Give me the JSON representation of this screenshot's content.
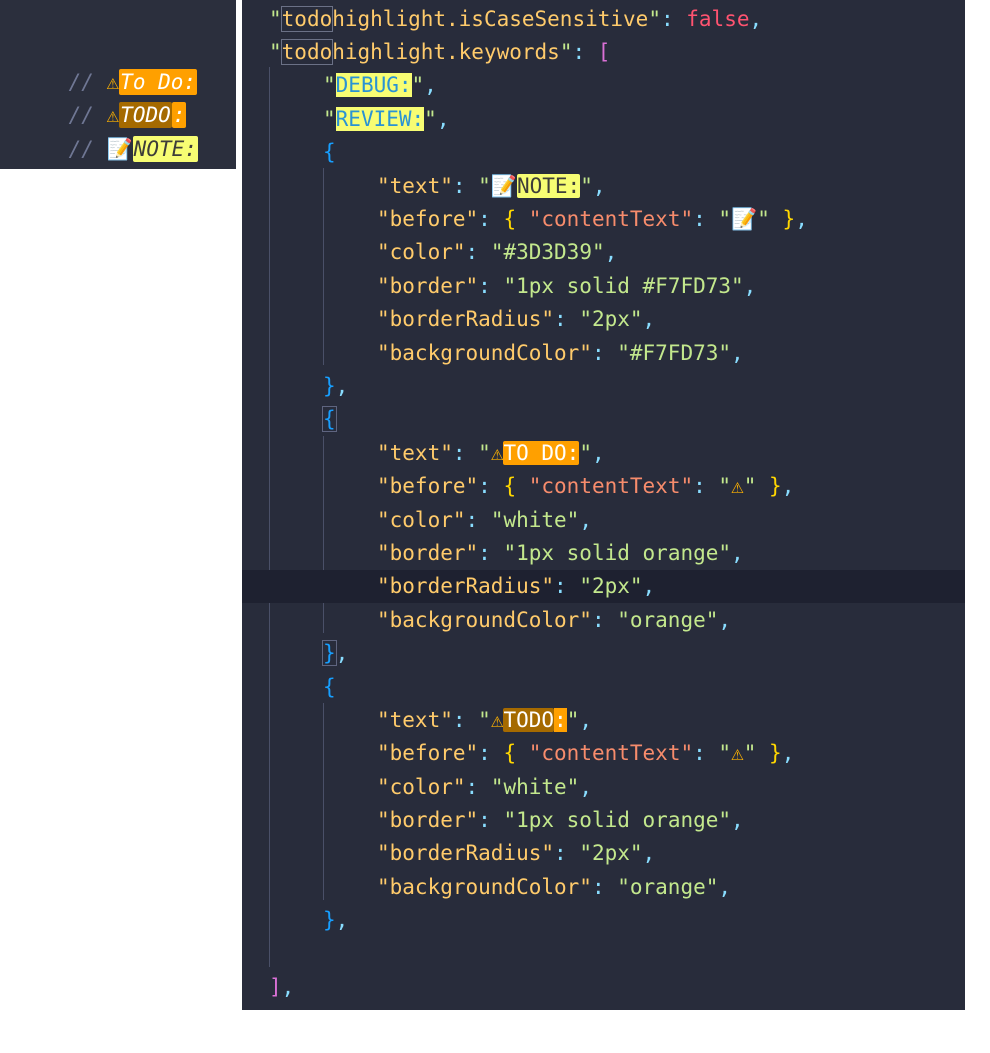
{
  "preview": {
    "rows": [
      {
        "comment": "// ",
        "icon": "⚠",
        "tag": "To Do:",
        "style": "orange"
      },
      {
        "comment": "// ",
        "icon": "⚠",
        "tag": "TODO",
        "colon": ":",
        "style": "dark"
      },
      {
        "comment": "// ",
        "icon": "📝",
        "tag": "NOTE:",
        "style": "yellow"
      }
    ]
  },
  "editor": {
    "lines": [
      {
        "q1": "\"",
        "k1": "todo",
        "k2": "highlight.isCaseSensitive",
        "q2": "\"",
        "sep": ": ",
        "val": "false",
        "tail": ","
      },
      {
        "q1": "\"",
        "k1": "todo",
        "k2": "highlight.keywords",
        "q2": "\"",
        "sep": ": ",
        "bracket": "["
      },
      {
        "s1": "\"",
        "tag": "DEBUG:",
        "s2": "\"",
        "tail": ","
      },
      {
        "s1": "\"",
        "tag": "REVIEW:",
        "s2": "\"",
        "tail": ","
      },
      {
        "brace": "{"
      },
      {
        "key": "\"text\"",
        "sep": ": ",
        "s1": "\"",
        "icon": "📝",
        "tag": "NOTE:",
        "s2": "\"",
        "tail": ","
      },
      {
        "key": "\"before\"",
        "sep": ": ",
        "o": "{ ",
        "ikey": "\"contentText\"",
        "isep": ": ",
        "s1": "\"",
        "icon": "📝",
        "s2": "\"",
        "c": " }",
        "tail": ","
      },
      {
        "key": "\"color\"",
        "sep": ": ",
        "val": "\"#3D3D39\"",
        "tail": ","
      },
      {
        "key": "\"border\"",
        "sep": ": ",
        "val": "\"1px solid #F7FD73\"",
        "tail": ","
      },
      {
        "key": "\"borderRadius\"",
        "sep": ": ",
        "val": "\"2px\"",
        "tail": ","
      },
      {
        "key": "\"backgroundColor\"",
        "sep": ": ",
        "val": "\"#F7FD73\"",
        "tail": ","
      },
      {
        "brace": "}",
        "tail": ","
      },
      {
        "brace": "{"
      },
      {
        "key": "\"text\"",
        "sep": ": ",
        "s1": "\"",
        "icon": "⚠",
        "tag": "TO DO:",
        "s2": "\"",
        "tail": ","
      },
      {
        "key": "\"before\"",
        "sep": ": ",
        "o": "{ ",
        "ikey": "\"contentText\"",
        "isep": ": ",
        "s1": "\"",
        "icon": "⚠",
        "s2": "\"",
        "c": " }",
        "tail": ","
      },
      {
        "key": "\"color\"",
        "sep": ": ",
        "val": "\"white\"",
        "tail": ","
      },
      {
        "key": "\"border\"",
        "sep": ": ",
        "val": "\"1px solid orange\"",
        "tail": ","
      },
      {
        "key": "\"borderRadius\"",
        "sep": ": ",
        "val": "\"2px\"",
        "tail": ","
      },
      {
        "key": "\"backgroundColor\"",
        "sep": ": ",
        "val": "\"orange\"",
        "tail": ","
      },
      {
        "brace": "}",
        "tail": ","
      },
      {
        "brace": "{"
      },
      {
        "key": "\"text\"",
        "sep": ": ",
        "s1": "\"",
        "icon": "⚠",
        "tag": "TODO",
        "tagcolon": ":",
        "s2": "\"",
        "tail": ","
      },
      {
        "key": "\"before\"",
        "sep": ": ",
        "o": "{ ",
        "ikey": "\"contentText\"",
        "isep": ": ",
        "s1": "\"",
        "icon": "⚠",
        "s2": "\"",
        "c": " }",
        "tail": ","
      },
      {
        "key": "\"color\"",
        "sep": ": ",
        "val": "\"white\"",
        "tail": ","
      },
      {
        "key": "\"border\"",
        "sep": ": ",
        "val": "\"1px solid orange\"",
        "tail": ","
      },
      {
        "key": "\"borderRadius\"",
        "sep": ": ",
        "val": "\"2px\"",
        "tail": ","
      },
      {
        "key": "\"backgroundColor\"",
        "sep": ": ",
        "val": "\"orange\"",
        "tail": ","
      },
      {
        "brace": "}",
        "tail": ","
      },
      {
        "empty": ""
      },
      {
        "bracket": "]",
        "tail": ","
      }
    ]
  },
  "colors": {
    "note_bg": "#F7FD73",
    "note_fg": "#3D3D39",
    "orange": "#FFA000",
    "dark_orange": "#A56A00"
  }
}
